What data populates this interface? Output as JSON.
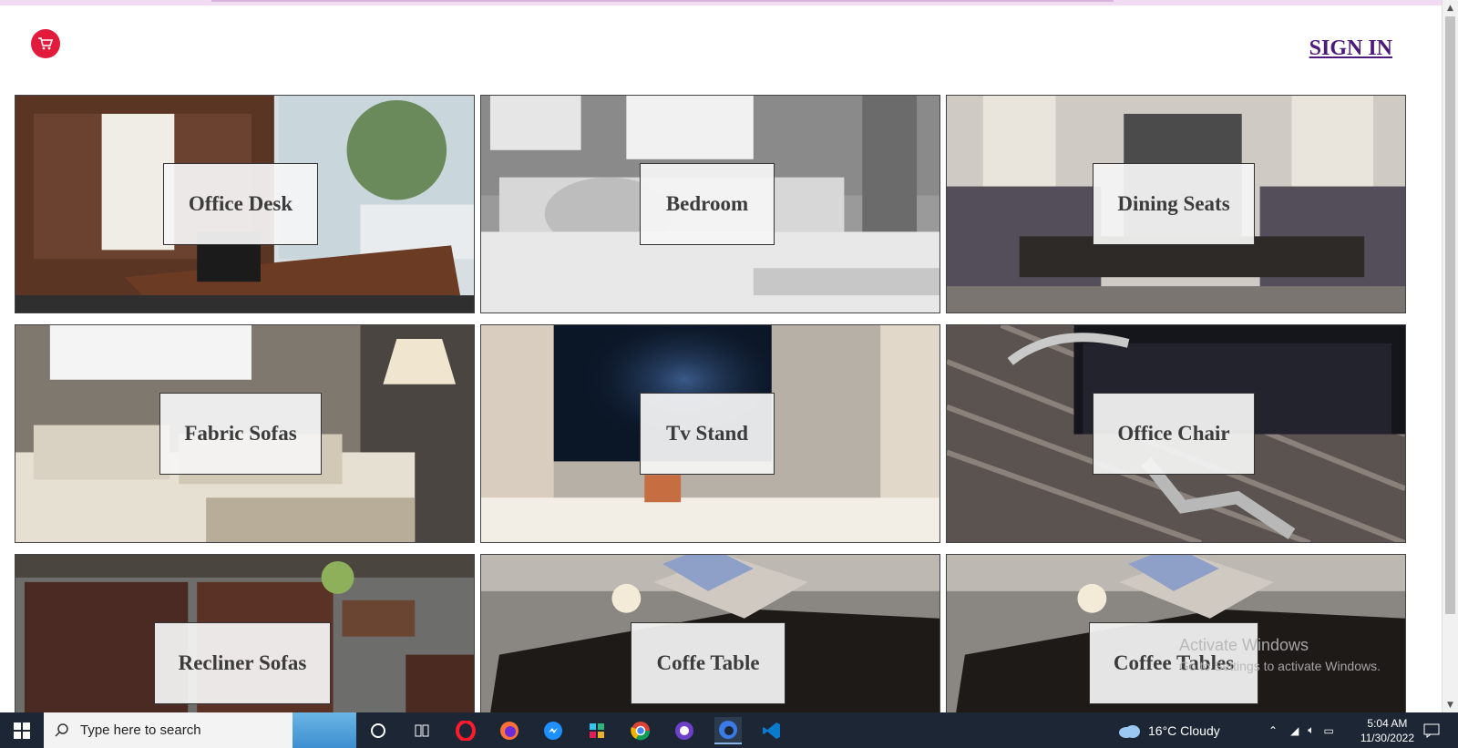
{
  "header": {
    "cart_icon": "shopping-cart-icon",
    "signin_label": "SIGN IN"
  },
  "categories": [
    {
      "label": "Office Desk"
    },
    {
      "label": "Bedroom"
    },
    {
      "label": "Dining Seats"
    },
    {
      "label": "Fabric Sofas"
    },
    {
      "label": "Tv Stand"
    },
    {
      "label": "Office Chair"
    },
    {
      "label": "Recliner Sofas"
    },
    {
      "label": "Coffe Table"
    },
    {
      "label": "Coffee Tables"
    }
  ],
  "watermark": {
    "line1": "Activate Windows",
    "line2": "Go to Settings to activate Windows."
  },
  "taskbar": {
    "search_placeholder": "Type here to search",
    "weather": "16°C  Cloudy",
    "time": "5:04 AM",
    "date": "11/30/2022",
    "apps": [
      "cortana-icon",
      "task-view-icon",
      "opera-icon",
      "firefox-icon",
      "messenger-icon",
      "slack-icon",
      "chrome-icon",
      "github-icon",
      "firefox-dev-icon",
      "vscode-icon"
    ]
  }
}
